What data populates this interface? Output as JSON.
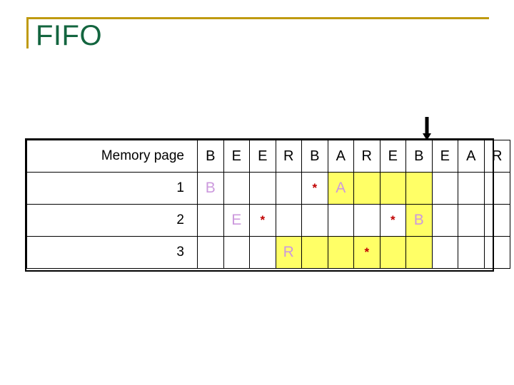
{
  "slide": {
    "title": "FIFO",
    "accent_color": "#bf9a10",
    "title_color": "#13653f",
    "highlight_color": "#ffff66",
    "letter_color": "#cc99dd",
    "star_color": "#c00000"
  },
  "arrow": {
    "name": "down-arrow",
    "glyph": "↓",
    "color": "#000000"
  },
  "table": {
    "row_header_label": "Memory page",
    "reference_string": [
      "B",
      "E",
      "E",
      "R",
      "B",
      "A",
      "R",
      "E",
      "B",
      "E",
      "A",
      "R"
    ],
    "row_labels": [
      "1",
      "2",
      "3"
    ],
    "rows": [
      {
        "label": "1",
        "cells": [
          {
            "text": "B",
            "kind": "letter",
            "highlight": false
          },
          {
            "text": "",
            "kind": "empty",
            "highlight": false
          },
          {
            "text": "",
            "kind": "empty",
            "highlight": false
          },
          {
            "text": "",
            "kind": "empty",
            "highlight": false
          },
          {
            "text": "*",
            "kind": "star",
            "highlight": false
          },
          {
            "text": "A",
            "kind": "letter",
            "highlight": true
          },
          {
            "text": "",
            "kind": "empty",
            "highlight": true
          },
          {
            "text": "",
            "kind": "empty",
            "highlight": true
          },
          {
            "text": "",
            "kind": "empty",
            "highlight": true
          },
          {
            "text": "",
            "kind": "empty",
            "highlight": false
          },
          {
            "text": "",
            "kind": "empty",
            "highlight": false
          },
          {
            "text": "",
            "kind": "empty",
            "highlight": false
          }
        ]
      },
      {
        "label": "2",
        "cells": [
          {
            "text": "",
            "kind": "empty",
            "highlight": false
          },
          {
            "text": "E",
            "kind": "letter",
            "highlight": false
          },
          {
            "text": "*",
            "kind": "star",
            "highlight": false
          },
          {
            "text": "",
            "kind": "empty",
            "highlight": false
          },
          {
            "text": "",
            "kind": "empty",
            "highlight": false
          },
          {
            "text": "",
            "kind": "empty",
            "highlight": false
          },
          {
            "text": "",
            "kind": "empty",
            "highlight": false
          },
          {
            "text": "*",
            "kind": "star",
            "highlight": false
          },
          {
            "text": "B",
            "kind": "letter",
            "highlight": true
          },
          {
            "text": "",
            "kind": "empty",
            "highlight": false
          },
          {
            "text": "",
            "kind": "empty",
            "highlight": false
          },
          {
            "text": "",
            "kind": "empty",
            "highlight": false
          }
        ]
      },
      {
        "label": "3",
        "cells": [
          {
            "text": "",
            "kind": "empty",
            "highlight": false
          },
          {
            "text": "",
            "kind": "empty",
            "highlight": false
          },
          {
            "text": "",
            "kind": "empty",
            "highlight": false
          },
          {
            "text": "R",
            "kind": "letter",
            "highlight": true
          },
          {
            "text": "",
            "kind": "empty",
            "highlight": true
          },
          {
            "text": "",
            "kind": "empty",
            "highlight": true
          },
          {
            "text": "*",
            "kind": "star",
            "highlight": true
          },
          {
            "text": "",
            "kind": "empty",
            "highlight": true
          },
          {
            "text": "",
            "kind": "empty",
            "highlight": true
          },
          {
            "text": "",
            "kind": "empty",
            "highlight": false
          },
          {
            "text": "",
            "kind": "empty",
            "highlight": false
          },
          {
            "text": "",
            "kind": "empty",
            "highlight": false
          }
        ]
      }
    ]
  }
}
